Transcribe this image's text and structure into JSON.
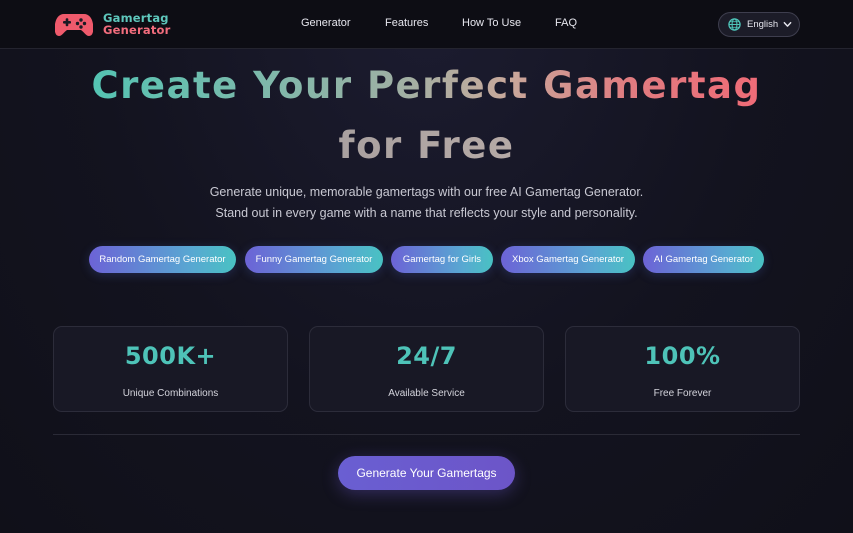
{
  "colors": {
    "accent_teal": "#4ec3b8",
    "accent_red": "#ef6b77",
    "accent_purple": "#6a5fd2",
    "background": "#13131f"
  },
  "header": {
    "logo": {
      "icon": "gamepad-icon",
      "line1": "Gamertag",
      "line2": "Generator"
    },
    "nav": [
      {
        "label": "Generator"
      },
      {
        "label": "Features"
      },
      {
        "label": "How To Use"
      },
      {
        "label": "FAQ"
      }
    ],
    "language": {
      "icon": "globe-icon",
      "label": "English",
      "chevron_icon": "chevron-down-icon"
    }
  },
  "hero": {
    "title_line1": "Create Your Perfect Gamertag",
    "title_line2": "for Free",
    "subtitle_line1": "Generate unique, memorable gamertags with our free AI Gamertag Generator.",
    "subtitle_line2": "Stand out in every game with a name that reflects your style and personality."
  },
  "categories": [
    {
      "label": "Random Gamertag Generator"
    },
    {
      "label": "Funny Gamertag Generator"
    },
    {
      "label": "Gamertag for Girls"
    },
    {
      "label": "Xbox Gamertag Generator"
    },
    {
      "label": "AI Gamertag Generator"
    }
  ],
  "stats": [
    {
      "value": "500K+",
      "label": "Unique Combinations"
    },
    {
      "value": "24/7",
      "label": "Available Service"
    },
    {
      "value": "100%",
      "label": "Free Forever"
    }
  ],
  "cta": {
    "label": "Generate Your Gamertags"
  }
}
